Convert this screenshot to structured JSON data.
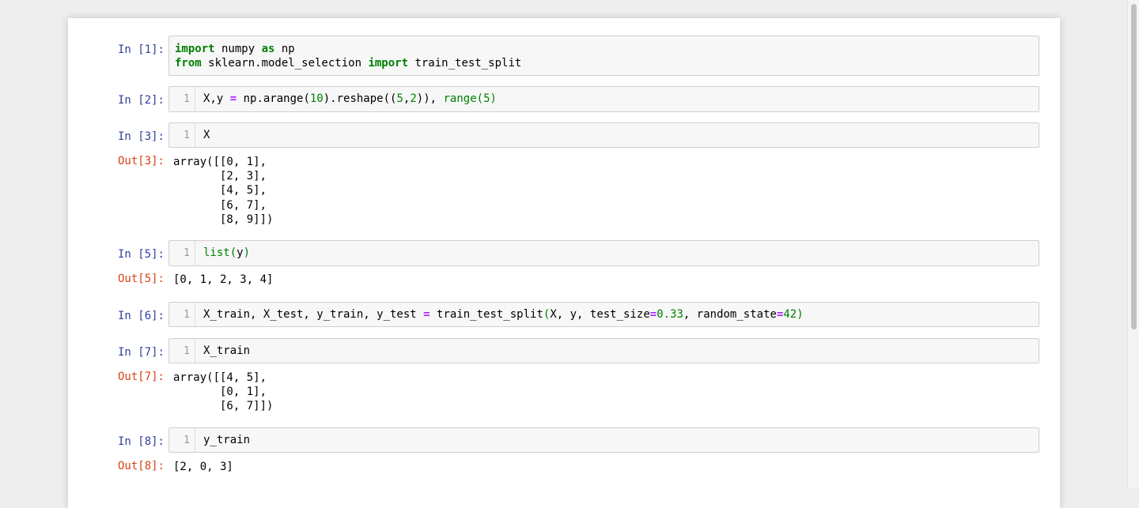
{
  "cells": [
    {
      "in_prompt": "In [1]:",
      "code_tokens": [
        [
          [
            "import",
            "kw"
          ],
          [
            " numpy ",
            ""
          ],
          [
            "as",
            "kw"
          ],
          [
            " np",
            ""
          ]
        ],
        [
          [
            "from",
            "kw"
          ],
          [
            " sklearn.model_selection ",
            ""
          ],
          [
            "import",
            "kw"
          ],
          [
            " train_test_split",
            ""
          ]
        ]
      ],
      "line_numbers": false
    },
    {
      "in_prompt": "In [2]:",
      "line_number": "1",
      "code_tokens": [
        [
          [
            "X,y ",
            ""
          ],
          [
            "=",
            "op"
          ],
          [
            " np.arange(",
            ""
          ],
          [
            "10",
            "num"
          ],
          [
            ").reshape((",
            ""
          ],
          [
            "5",
            "num"
          ],
          [
            ",",
            ""
          ],
          [
            "2",
            "num"
          ],
          [
            ")), ",
            ""
          ],
          [
            "range",
            "nb"
          ],
          [
            "(",
            "nb"
          ],
          [
            "5",
            "num"
          ],
          [
            ")",
            "nb"
          ]
        ]
      ]
    },
    {
      "in_prompt": "In [3]:",
      "line_number": "1",
      "code_tokens": [
        [
          [
            "X",
            ""
          ]
        ]
      ],
      "out_prompt": "Out[3]:",
      "output": "array([[0, 1],\n       [2, 3],\n       [4, 5],\n       [6, 7],\n       [8, 9]])"
    },
    {
      "in_prompt": "In [5]:",
      "line_number": "1",
      "code_tokens": [
        [
          [
            "list",
            "nb"
          ],
          [
            "(",
            "nb"
          ],
          [
            "y",
            ""
          ],
          [
            ")",
            "nb"
          ]
        ]
      ],
      "out_prompt": "Out[5]:",
      "output": "[0, 1, 2, 3, 4]"
    },
    {
      "in_prompt": "In [6]:",
      "line_number": "1",
      "code_tokens": [
        [
          [
            "X_train, X_test, y_train, y_test ",
            ""
          ],
          [
            "=",
            "op"
          ],
          [
            " train_test_split",
            ""
          ],
          [
            "(",
            "nb"
          ],
          [
            "X, y, test_size",
            ""
          ],
          [
            "=",
            "op"
          ],
          [
            "0.33",
            "num"
          ],
          [
            ", random_state",
            ""
          ],
          [
            "=",
            "op"
          ],
          [
            "42",
            "num"
          ],
          [
            ")",
            "nb"
          ]
        ]
      ]
    },
    {
      "in_prompt": "In [7]:",
      "line_number": "1",
      "code_tokens": [
        [
          [
            "X_train",
            ""
          ]
        ]
      ],
      "out_prompt": "Out[7]:",
      "output": "array([[4, 5],\n       [0, 1],\n       [6, 7]])"
    },
    {
      "in_prompt": "In [8]:",
      "line_number": "1",
      "code_tokens": [
        [
          [
            "y_train",
            ""
          ]
        ]
      ],
      "out_prompt": "Out[8]:",
      "output": "[2, 0, 3]"
    }
  ],
  "colors": {
    "in_prompt": "#303f9f",
    "out_prompt": "#d84315",
    "keyword": "#008000",
    "number": "#008000",
    "builtin": "#008000",
    "operator": "#aa22ff",
    "cell_background": "#f7f7f7",
    "page_background": "#eeeeee"
  }
}
